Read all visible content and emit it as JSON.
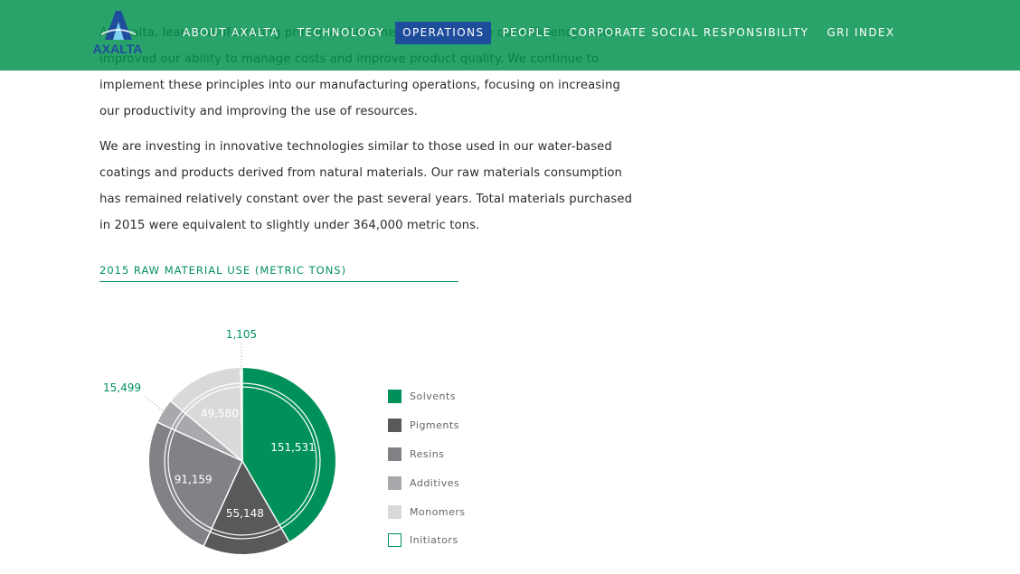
{
  "nav": {
    "items": [
      {
        "label": "ABOUT AXALTA",
        "active": false
      },
      {
        "label": "TECHNOLOGY",
        "active": false
      },
      {
        "label": "OPERATIONS",
        "active": true
      },
      {
        "label": "PEOPLE",
        "active": false
      },
      {
        "label": "CORPORATE SOCIAL RESPONSIBILITY",
        "active": false
      },
      {
        "label": "GRI INDEX",
        "active": false
      }
    ],
    "logo_text": "AXALTA"
  },
  "content": {
    "paragraphs": [
      "At Axalta, lean manufacturing principles have helped us improve our efficiency, have improved our ability to manage costs and improve product quality. We continue to implement these principles into our manufacturing operations, focusing on increasing our productivity and improving the use of resources.",
      "We are investing in innovative technologies similar to those used in our water-based coatings and products derived from natural materials. Our raw materials consumption has remained relatively constant over the past several years. Total materials purchased in 2015 were equivalent to slightly under 364,000 metric tons."
    ]
  },
  "colors": {
    "brand_green": "#00915a",
    "nav_active": "#1e4d9c"
  },
  "chart_data": {
    "type": "pie",
    "title": "2015 RAW MATERIAL USE (METRIC TONS)",
    "categories": [
      "Solvents",
      "Pigments",
      "Resins",
      "Additives",
      "Monomers",
      "Initiators"
    ],
    "values": [
      151531,
      55148,
      91159,
      15499,
      49580,
      1105
    ],
    "value_labels": [
      "151,531",
      "55,148",
      "91,159",
      "15,499",
      "49,580",
      "1,105"
    ],
    "colors": [
      "#00915a",
      "#58595b",
      "#808285",
      "#a7a9ac",
      "#d9d9da",
      "#ffffff"
    ],
    "legend_position": "right"
  }
}
